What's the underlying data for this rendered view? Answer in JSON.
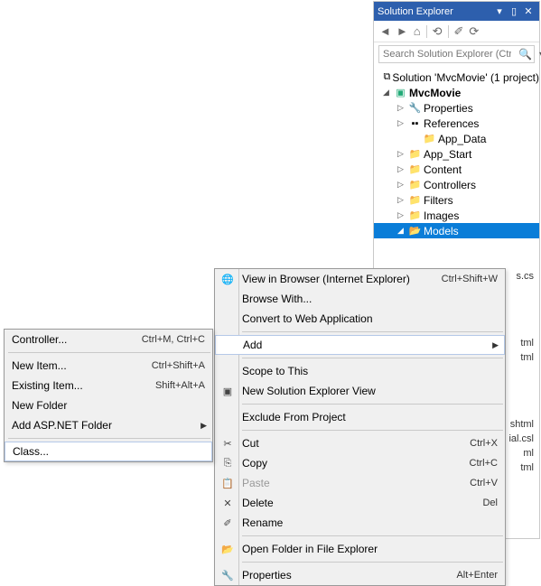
{
  "panel": {
    "title": "Solution Explorer",
    "search_placeholder": "Search Solution Explorer (Ctrl",
    "solution": "Solution 'MvcMovie' (1 project)",
    "project": "MvcMovie",
    "items": {
      "properties": "Properties",
      "references": "References",
      "app_data": "App_Data",
      "app_start": "App_Start",
      "content": "Content",
      "controllers": "Controllers",
      "filters": "Filters",
      "images": "Images",
      "models": "Models"
    },
    "ghosts": [
      "s.cs",
      "tml",
      "tml",
      "shtml",
      "ial.csl",
      "ml",
      "tml"
    ],
    "toolbar": {
      "back": "◄",
      "fwd": "►",
      "home": "⌂",
      "scope": "⟲",
      "show": "✐",
      "refresh": "⟳"
    }
  },
  "context": {
    "view_browser": "View in Browser (Internet Explorer)",
    "view_browser_key": "Ctrl+Shift+W",
    "browse_with": "Browse With...",
    "convert": "Convert to Web Application",
    "add": "Add",
    "scope": "Scope to This",
    "new_view": "New Solution Explorer View",
    "exclude": "Exclude From Project",
    "cut": "Cut",
    "cut_key": "Ctrl+X",
    "copy": "Copy",
    "copy_key": "Ctrl+C",
    "paste": "Paste",
    "paste_key": "Ctrl+V",
    "delete": "Delete",
    "delete_key": "Del",
    "rename": "Rename",
    "open_folder": "Open Folder in File Explorer",
    "props": "Properties",
    "props_key": "Alt+Enter"
  },
  "submenu": {
    "controller": "Controller...",
    "controller_key": "Ctrl+M, Ctrl+C",
    "new_item": "New Item...",
    "new_item_key": "Ctrl+Shift+A",
    "existing": "Existing Item...",
    "existing_key": "Shift+Alt+A",
    "new_folder": "New Folder",
    "aspnet": "Add ASP.NET Folder",
    "class": "Class..."
  }
}
